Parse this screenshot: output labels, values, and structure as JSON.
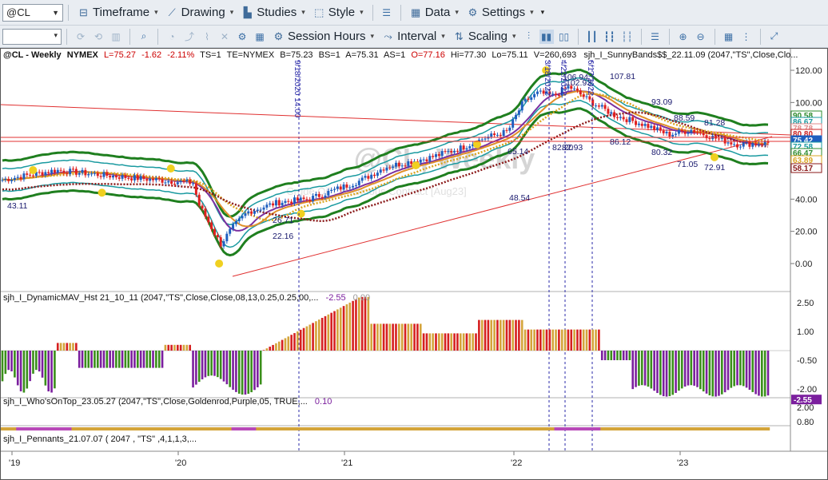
{
  "toolbar1": {
    "symbol": "@CL",
    "timeframe": "Timeframe",
    "drawing": "Drawing",
    "studies": "Studies",
    "style": "Style",
    "data": "Data",
    "settings": "Settings"
  },
  "toolbar2": {
    "session_hours": "Session Hours",
    "interval": "Interval",
    "scaling": "Scaling"
  },
  "price_header": {
    "symbol": "@CL - Weekly",
    "exchange": "NYMEX",
    "last": "L=75.27",
    "change": "-1.62",
    "pct_change": "-2.11%",
    "ts": "TS=1",
    "te": "TE=NYMEX",
    "bid": "B=75.23",
    "bidsize": "BS=1",
    "ask": "A=75.31",
    "asksize": "AS=1",
    "open": "O=77.16",
    "high": "Hi=77.30",
    "low": "Lo=75.11",
    "volume": "V=260,693",
    "study": "sjh_I_SunnyBands$$_22.11.09 (2047,\"TS\",Close,Clo..."
  },
  "watermark": "@CL, Weekly",
  "watermark_sub": "Crude Oil Continuous Contract [Aug23]",
  "price_axis": {
    "ticks": [
      "120.00",
      "100.00",
      "80.00",
      "60.00",
      "40.00",
      "20.00",
      "0.00"
    ]
  },
  "price_labels": [
    {
      "text": "90.58",
      "color": "#2e8b2e"
    },
    {
      "text": "86.67",
      "color": "#1a9aa0"
    },
    {
      "text": "78.78",
      "color": "#e08a8a"
    },
    {
      "text": "80.80",
      "color": "#cc2222"
    },
    {
      "text": "75.42",
      "color": "#1f5fbf"
    },
    {
      "text": "72.58",
      "color": "#1a9aa0"
    },
    {
      "text": "66.47",
      "color": "#2e8b2e"
    },
    {
      "text": "63.89",
      "color": "#daa520"
    },
    {
      "text": "58.17",
      "color": "#8b1a1a"
    }
  ],
  "annotations": [
    {
      "text": "43.11"
    },
    {
      "text": "26.71"
    },
    {
      "text": "22.16"
    },
    {
      "text": "65.14"
    },
    {
      "text": "48.54"
    },
    {
      "text": "82.20"
    },
    {
      "text": "82.93"
    },
    {
      "text": "106.94"
    },
    {
      "text": "102.93"
    },
    {
      "text": "107.81"
    },
    {
      "text": "93.09"
    },
    {
      "text": "86.12"
    },
    {
      "text": "80.32"
    },
    {
      "text": "88.59"
    },
    {
      "text": "81.28"
    },
    {
      "text": "71.05"
    },
    {
      "text": "72.91"
    }
  ],
  "vertical_labels": [
    {
      "text": "9/18/2020 14:00"
    },
    {
      "text": "3/18/2022"
    },
    {
      "text": "4/22/2022"
    },
    {
      "text": "6/17/2022"
    }
  ],
  "pane2": {
    "title": "sjh_I_DynamicMAV_Hst 21_10_11 (2047,\"TS\",Close,Close,08,13,0.25,0.25,00,...",
    "value1": "-2.55",
    "value2": "0.00",
    "ticks": [
      "2.50",
      "1.00",
      "-0.50",
      "-2.00"
    ],
    "last_label": "-2.55"
  },
  "pane3": {
    "title": "sjh_I_Who'sOnTop_23.05.27 (2047,\"TS\",Close,Goldenrod,Purple,05, TRUE,...",
    "value": "0.10",
    "ticks": [
      "2.00",
      "0.80"
    ]
  },
  "pane4": {
    "title": "sjh_I_Pennants_21.07.07 ( 2047 , \"TS\" ,4,1,1,3,..."
  },
  "time_axis": {
    "labels": [
      "'19",
      "'20",
      "'21",
      "'22",
      "'23"
    ]
  },
  "colors": {
    "up_bar": "#1f5fbf",
    "down_bar": "#e02020",
    "outer_band": "#1f7f1f",
    "inner_band": "#1a9aa0",
    "ma_gold": "#daa520",
    "ma_purple": "#7b2fa0",
    "ma_orange": "#e0902a",
    "ma_dark": "#8b1a1a",
    "hist_green": "#3a8f1a",
    "hist_purple": "#7b1f9e",
    "hist_gold": "#d4a43a",
    "hist_red": "#d62020"
  }
}
